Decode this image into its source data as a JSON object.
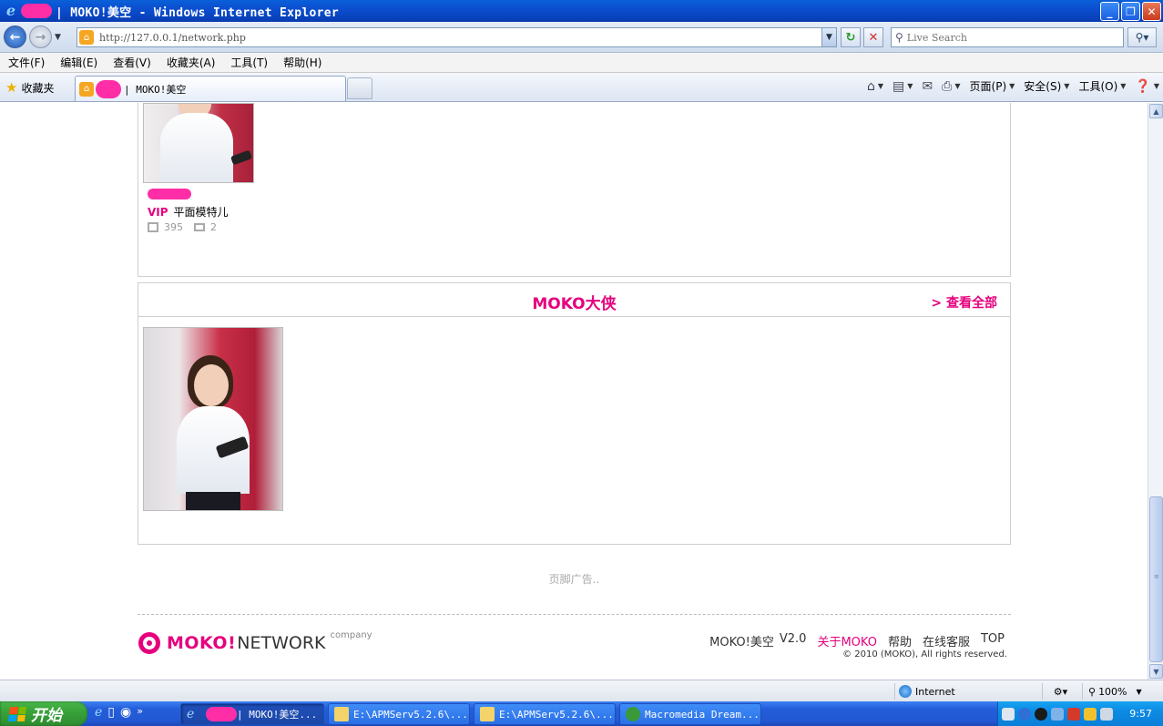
{
  "window": {
    "title": "| MOKO!美空 - Windows Internet Explorer",
    "minimize": "_",
    "maximize": "❐",
    "close": "✕"
  },
  "address": {
    "url": "http://127.0.0.1/network.php",
    "search_placeholder": "Live Search"
  },
  "menu": {
    "items": [
      "文件(F)",
      "编辑(E)",
      "查看(V)",
      "收藏夹(A)",
      "工具(T)",
      "帮助(H)"
    ]
  },
  "favbar": {
    "favorites_label": "收藏夹",
    "tab_title": "| MOKO!美空",
    "commands": [
      "页面(P)",
      "安全(S)",
      "工具(O)"
    ]
  },
  "user": {
    "vip": "VIP",
    "type": "平面模特儿",
    "photos": "395",
    "messages": "2"
  },
  "section": {
    "title": "MOKO大侠",
    "more": "> 查看全部"
  },
  "footer": {
    "ad": "页脚广告..",
    "logo_moko": "MOKO!",
    "logo_network": "NETWORK",
    "logo_company": "company",
    "links": [
      "MOKO!美空",
      "V2.0",
      "关于MOKO",
      "帮助",
      "在线客服",
      "TOP"
    ],
    "copyright": "© 2010 (MOKO), All rights reserved."
  },
  "status": {
    "zone": "Internet",
    "zoom": "100%"
  },
  "taskbar": {
    "start": "开始",
    "tasks": [
      "| MOKO!美空...",
      "E:\\APMServ5.2.6\\...",
      "E:\\APMServ5.2.6\\...",
      "Macromedia Dream..."
    ],
    "clock": "9:57"
  },
  "colors": {
    "accent": "#e6007e",
    "titlebar": "#0b4fd0"
  }
}
